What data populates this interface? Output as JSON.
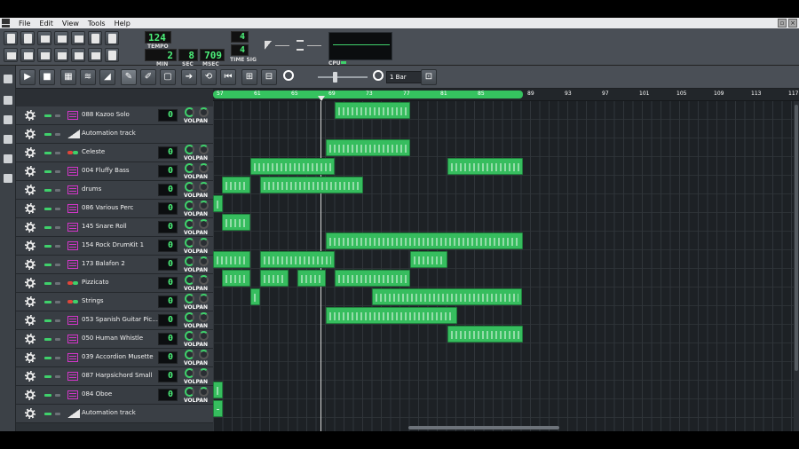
{
  "menu": [
    {
      "label": "File"
    },
    {
      "label": "Edit"
    },
    {
      "label": "View"
    },
    {
      "label": "Tools"
    },
    {
      "label": "Help"
    }
  ],
  "transport": {
    "tempo": "124",
    "tempo_label": "TEMPO",
    "time_sig_num": "4",
    "time_sig_den": "4",
    "time_sig_label": "TIME SIG",
    "min": "2",
    "sec": "8",
    "msec": "709",
    "min_label": "MIN",
    "sec_label": "SEC",
    "msec_label": "MSEC",
    "cpu_label": "CPU"
  },
  "song_editor": {
    "zoom": "1 Bar",
    "timeline_ticks": [
      "57",
      "61",
      "65",
      "69",
      "73",
      "77",
      "81",
      "85",
      "89",
      "93",
      "97",
      "101",
      "105",
      "109",
      "113",
      "117"
    ],
    "tracks": [
      {
        "name": "088 Kazoo Solo",
        "type": "instrument",
        "volume": "0"
      },
      {
        "name": "Automation track",
        "type": "automation"
      },
      {
        "name": "Celeste",
        "type": "plugin",
        "volume": "0"
      },
      {
        "name": "004 Fluffy Bass",
        "type": "instrument",
        "volume": "0"
      },
      {
        "name": "drums",
        "type": "instrument",
        "volume": "0"
      },
      {
        "name": "086 Various Perc",
        "type": "instrument",
        "volume": "0"
      },
      {
        "name": "145 Snare Roll",
        "type": "instrument",
        "volume": "0"
      },
      {
        "name": "154 Rock DrumKit 1",
        "type": "instrument",
        "volume": "0"
      },
      {
        "name": "173 Balafon 2",
        "type": "instrument",
        "volume": "0"
      },
      {
        "name": "Pizzicato",
        "type": "plugin",
        "volume": "0"
      },
      {
        "name": "Strings",
        "type": "plugin",
        "volume": "0"
      },
      {
        "name": "053 Spanish Guitar Pic...",
        "type": "instrument",
        "volume": "0"
      },
      {
        "name": "050 Human Whistle",
        "type": "instrument",
        "volume": "0"
      },
      {
        "name": "039 Accordion Musette",
        "type": "instrument",
        "volume": "0"
      },
      {
        "name": "087 Harpsichord Small",
        "type": "instrument",
        "volume": "0"
      },
      {
        "name": "084 Oboe",
        "type": "instrument",
        "volume": "0"
      },
      {
        "name": "Automation track",
        "type": "automation"
      }
    ],
    "vol_label": "VOL",
    "pan_label": "PAN"
  },
  "colors": {
    "clip": "#36bd5e",
    "lcd": "#4cf07a",
    "instrument_icon": "#d236c8"
  }
}
